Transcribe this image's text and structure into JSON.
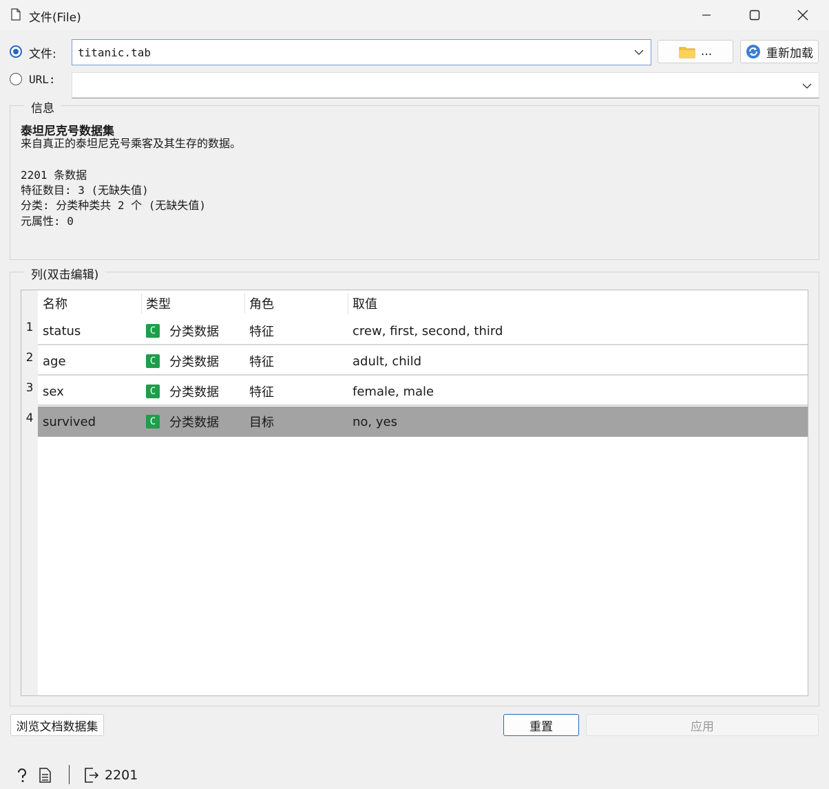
{
  "window": {
    "title": "文件(File)"
  },
  "source": {
    "file_label": "文件:",
    "file_value": "titanic.tab",
    "browse_label": "...",
    "reload_label": "重新加载",
    "url_label": "URL:",
    "url_value": ""
  },
  "info": {
    "group_title": "信息",
    "heading": "泰坦尼克号数据集",
    "description": "来自真正的泰坦尼克号乘客及其生存的数据。",
    "rows_line": "2201 条数据",
    "features_line": "特征数目: 3 (无缺失值)",
    "class_line": "分类: 分类种类共 2 个 (无缺失值)",
    "meta_line": "元属性: 0"
  },
  "columns": {
    "group_title": "列(双击编辑)",
    "headers": [
      "名称",
      "类型",
      "角色",
      "取值"
    ],
    "rows": [
      {
        "num": "1",
        "name": "status",
        "type_badge": "C",
        "type": "分类数据",
        "role": "特征",
        "values": "crew, first, second, third",
        "selected": false
      },
      {
        "num": "2",
        "name": "age",
        "type_badge": "C",
        "type": "分类数据",
        "role": "特征",
        "values": "adult, child",
        "selected": false
      },
      {
        "num": "3",
        "name": "sex",
        "type_badge": "C",
        "type": "分类数据",
        "role": "特征",
        "values": "female, male",
        "selected": false
      },
      {
        "num": "4",
        "name": "survived",
        "type_badge": "C",
        "type": "分类数据",
        "role": "目标",
        "values": "no, yes",
        "selected": true
      }
    ]
  },
  "buttons": {
    "browse_docs": "浏览文档数据集",
    "reset": "重置",
    "apply": "应用"
  },
  "statusbar": {
    "output_count": "2201"
  },
  "colors": {
    "accent": "#2667c4",
    "badge": "#1e9e4a",
    "selected_row": "#a3a3a3"
  }
}
